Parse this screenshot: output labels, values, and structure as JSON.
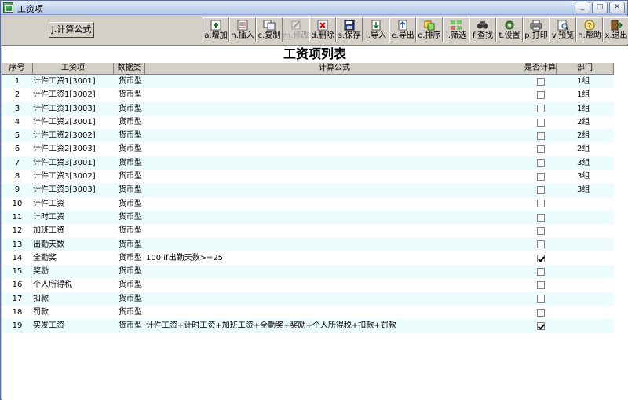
{
  "window": {
    "title": "工资项"
  },
  "window_buttons": [
    "_",
    "□",
    "✕"
  ],
  "toolbar": {
    "calc_button": "J.计算公式",
    "tools": [
      {
        "key": "a",
        "label": ".增加",
        "icon": "add-icon",
        "disabled": false
      },
      {
        "key": "n",
        "label": ".插入",
        "icon": "insert-icon",
        "disabled": false
      },
      {
        "key": "c",
        "label": ".复制",
        "icon": "copy-icon",
        "disabled": false
      },
      {
        "key": "m",
        "label": ".修改",
        "icon": "edit-icon",
        "disabled": true
      },
      {
        "key": "d",
        "label": ".删除",
        "icon": "delete-icon",
        "disabled": false
      },
      {
        "key": "s",
        "label": ".保存",
        "icon": "save-icon",
        "disabled": false
      },
      {
        "key": "i",
        "label": ".导入",
        "icon": "import-icon",
        "disabled": false
      },
      {
        "key": "e",
        "label": ".导出",
        "icon": "export-icon",
        "disabled": false
      },
      {
        "key": "o",
        "label": ".排序",
        "icon": "sort-icon",
        "disabled": false
      },
      {
        "key": "l",
        "label": ".筛选",
        "icon": "filter-icon",
        "disabled": false
      },
      {
        "key": "f",
        "label": ".查找",
        "icon": "find-icon",
        "disabled": false
      },
      {
        "key": "t",
        "label": ".设置",
        "icon": "settings-icon",
        "disabled": false
      },
      {
        "key": "p",
        "label": ".打印",
        "icon": "print-icon",
        "disabled": false
      },
      {
        "key": "v",
        "label": ".预览",
        "icon": "preview-icon",
        "disabled": false
      },
      {
        "key": "h",
        "label": ".帮助",
        "icon": "help-icon",
        "disabled": false
      },
      {
        "key": "x",
        "label": ".退出",
        "icon": "exit-icon",
        "disabled": false
      }
    ]
  },
  "grid": {
    "title": "工资项列表",
    "columns": [
      "序号",
      "工资项",
      "数据类型",
      "计算公式",
      "是否计算",
      "部门"
    ],
    "rows": [
      {
        "no": "1",
        "name": "计件工资1[3001]",
        "type": "货币型",
        "formula": "",
        "calc": false,
        "dept": "1组"
      },
      {
        "no": "2",
        "name": "计件工资1[3002]",
        "type": "货币型",
        "formula": "",
        "calc": false,
        "dept": "1组"
      },
      {
        "no": "3",
        "name": "计件工资1[3003]",
        "type": "货币型",
        "formula": "",
        "calc": false,
        "dept": "1组"
      },
      {
        "no": "4",
        "name": "计件工资2[3001]",
        "type": "货币型",
        "formula": "",
        "calc": false,
        "dept": "2组"
      },
      {
        "no": "5",
        "name": "计件工资2[3002]",
        "type": "货币型",
        "formula": "",
        "calc": false,
        "dept": "2组"
      },
      {
        "no": "6",
        "name": "计件工资2[3003]",
        "type": "货币型",
        "formula": "",
        "calc": false,
        "dept": "2组"
      },
      {
        "no": "7",
        "name": "计件工资3[3001]",
        "type": "货币型",
        "formula": "",
        "calc": false,
        "dept": "3组"
      },
      {
        "no": "8",
        "name": "计件工资3[3002]",
        "type": "货币型",
        "formula": "",
        "calc": false,
        "dept": "3组"
      },
      {
        "no": "9",
        "name": "计件工资3[3003]",
        "type": "货币型",
        "formula": "",
        "calc": false,
        "dept": "3组"
      },
      {
        "no": "10",
        "name": "计件工资",
        "type": "货币型",
        "formula": "",
        "calc": false,
        "dept": ""
      },
      {
        "no": "11",
        "name": "计时工资",
        "type": "货币型",
        "formula": "",
        "calc": false,
        "dept": ""
      },
      {
        "no": "12",
        "name": "加班工资",
        "type": "货币型",
        "formula": "",
        "calc": false,
        "dept": ""
      },
      {
        "no": "13",
        "name": "出勤天数",
        "type": "货币型",
        "formula": "",
        "calc": false,
        "dept": ""
      },
      {
        "no": "14",
        "name": "全勤奖",
        "type": "货币型",
        "formula": "100 if出勤天数>=25",
        "calc": true,
        "dept": ""
      },
      {
        "no": "15",
        "name": "奖励",
        "type": "货币型",
        "formula": "",
        "calc": false,
        "dept": ""
      },
      {
        "no": "16",
        "name": "个人所得税",
        "type": "货币型",
        "formula": "",
        "calc": false,
        "dept": ""
      },
      {
        "no": "17",
        "name": "扣款",
        "type": "货币型",
        "formula": "",
        "calc": false,
        "dept": ""
      },
      {
        "no": "18",
        "name": "罚款",
        "type": "货币型",
        "formula": "",
        "calc": false,
        "dept": ""
      },
      {
        "no": "19",
        "name": "实发工资",
        "type": "货币型",
        "formula": "计件工资+计时工资+加班工资+全勤奖+奖励+个人所得税+扣款+罚款",
        "calc": true,
        "dept": ""
      }
    ]
  }
}
